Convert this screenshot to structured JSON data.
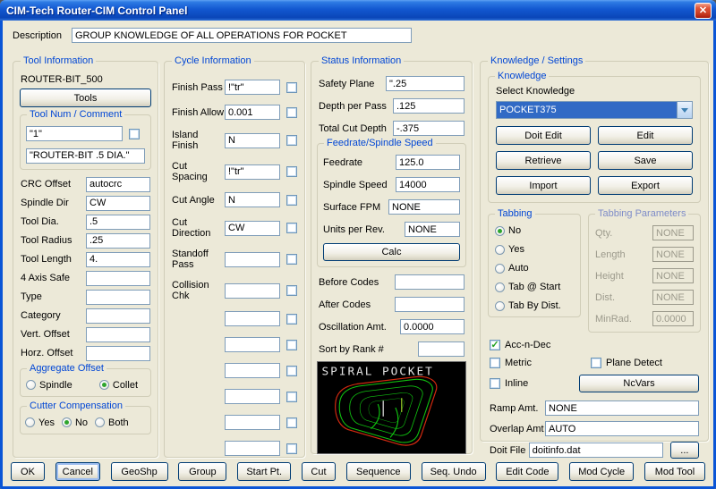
{
  "window": {
    "title": "CIM-Tech Router-CIM Control Panel",
    "close_glyph": "✕"
  },
  "description": {
    "label": "Description",
    "value": "GROUP KNOWLEDGE OF ALL OPERATIONS FOR POCKET"
  },
  "colors": {
    "titlebar_blue": "#1257D0",
    "group_caption_blue": "#0046D5",
    "combo_select_blue": "#316AC5",
    "preview_red": "#D42A10",
    "preview_green": "#10C010"
  },
  "tool": {
    "title": "Tool Information",
    "tool_name": "ROUTER-BIT_500",
    "tools_button": "Tools",
    "num_group_title": "Tool Num / Comment",
    "tool_num": "\"1\"",
    "tool_comment": "\"ROUTER-BIT .5 DIA.\"",
    "rows": [
      {
        "label": "CRC Offset",
        "value": "autocrc"
      },
      {
        "label": "Spindle Dir",
        "value": "CW"
      },
      {
        "label": "Tool Dia.",
        "value": ".5"
      },
      {
        "label": "Tool Radius",
        "value": ".25"
      },
      {
        "label": "Tool Length",
        "value": "4."
      },
      {
        "label": "4 Axis Safe",
        "value": ""
      },
      {
        "label": "Type",
        "value": ""
      },
      {
        "label": "Category",
        "value": ""
      },
      {
        "label": "Vert. Offset",
        "value": ""
      },
      {
        "label": "Horz. Offset",
        "value": ""
      }
    ],
    "aggregate": {
      "title": "Aggregate Offset",
      "options": [
        {
          "label": "Spindle"
        },
        {
          "label": "Collet"
        }
      ],
      "selected": "Collet"
    },
    "cutter": {
      "title": "Cutter Compensation",
      "options": [
        {
          "label": "Yes"
        },
        {
          "label": "No"
        },
        {
          "label": "Both"
        }
      ],
      "selected": "No"
    }
  },
  "cycle": {
    "title": "Cycle Information",
    "rows": [
      {
        "label": "Finish Pass",
        "value": "!\"tr\""
      },
      {
        "label": "Finish Allow",
        "value": "0.001"
      },
      {
        "label": "Island Finish",
        "value": "N"
      },
      {
        "label": "Cut Spacing",
        "value": "!\"tr\""
      },
      {
        "label": "Cut Angle",
        "value": "N"
      },
      {
        "label": "Cut Direction",
        "value": "CW"
      },
      {
        "label": "Standoff Pass",
        "value": ""
      },
      {
        "label": "Collision Chk",
        "value": ""
      }
    ],
    "extra_rows": [
      {
        "value": ""
      },
      {
        "value": ""
      },
      {
        "value": ""
      },
      {
        "value": ""
      },
      {
        "value": ""
      },
      {
        "value": ""
      }
    ]
  },
  "status": {
    "title": "Status Information",
    "rows": [
      {
        "label": "Safety Plane",
        "value": "\".25"
      },
      {
        "label": "Depth per Pass",
        "value": ".125"
      },
      {
        "label": "Total Cut Depth",
        "value": "-.375"
      }
    ],
    "feed_group": {
      "title": "Feedrate/Spindle Speed",
      "rows": [
        {
          "label": "Feedrate",
          "value": "125.0"
        },
        {
          "label": "Spindle Speed",
          "value": "14000"
        },
        {
          "label": "Surface FPM",
          "value": "NONE"
        },
        {
          "label": "Units per Rev.",
          "value": "NONE"
        }
      ],
      "calc_button": "Calc"
    },
    "rows2": [
      {
        "label": "Before Codes",
        "value": ""
      },
      {
        "label": "After Codes",
        "value": ""
      },
      {
        "label": "Oscillation Amt.",
        "value": "0.0000"
      },
      {
        "label": "Sort by Rank #",
        "value": ""
      }
    ],
    "preview_label": "SPIRAL POCKET"
  },
  "knowledge": {
    "title": "Knowledge / Settings",
    "group_title": "Knowledge",
    "select_label": "Select Knowledge",
    "selected_knowledge": "POCKET375",
    "buttons": [
      {
        "label": "Doit Edit"
      },
      {
        "label": "Edit"
      },
      {
        "label": "Retrieve"
      },
      {
        "label": "Save"
      },
      {
        "label": "Import"
      },
      {
        "label": "Export"
      }
    ],
    "tabbing": {
      "title": "Tabbing",
      "options": [
        {
          "label": "No"
        },
        {
          "label": "Yes"
        },
        {
          "label": "Auto"
        },
        {
          "label": "Tab @ Start"
        },
        {
          "label": "Tab By Dist."
        }
      ],
      "selected": "No"
    },
    "tabbing_params": {
      "title": "Tabbing Parameters",
      "rows": [
        {
          "label": "Qty.",
          "value": "NONE"
        },
        {
          "label": "Length",
          "value": "NONE"
        },
        {
          "label": "Height",
          "value": "NONE"
        },
        {
          "label": "Dist.",
          "value": "NONE"
        },
        {
          "label": "MinRad.",
          "value": "0.0000"
        }
      ]
    },
    "checkboxes": {
      "acc": {
        "label": "Acc-n-Dec",
        "checked": true,
        "glyph": "✓"
      },
      "metric": {
        "label": "Metric",
        "checked": false
      },
      "plane": {
        "label": "Plane Detect",
        "checked": false
      },
      "inline": {
        "label": "Inline",
        "checked": false
      }
    },
    "ncvars_button": "NcVars",
    "ramp": {
      "label": "Ramp Amt.",
      "value": "NONE"
    },
    "overlap": {
      "label": "Overlap Amt",
      "value": "AUTO"
    },
    "doit": {
      "label": "Doit File",
      "value": "doitinfo.dat",
      "browse": "..."
    }
  },
  "footer": {
    "buttons": [
      {
        "label": "OK"
      },
      {
        "label": "Cancel"
      },
      {
        "label": "GeoShp"
      },
      {
        "label": "Group"
      },
      {
        "label": "Start Pt."
      },
      {
        "label": "Cut"
      },
      {
        "label": "Sequence"
      },
      {
        "label": "Seq. Undo"
      },
      {
        "label": "Edit Code"
      },
      {
        "label": "Mod Cycle"
      },
      {
        "label": "Mod Tool"
      }
    ]
  }
}
